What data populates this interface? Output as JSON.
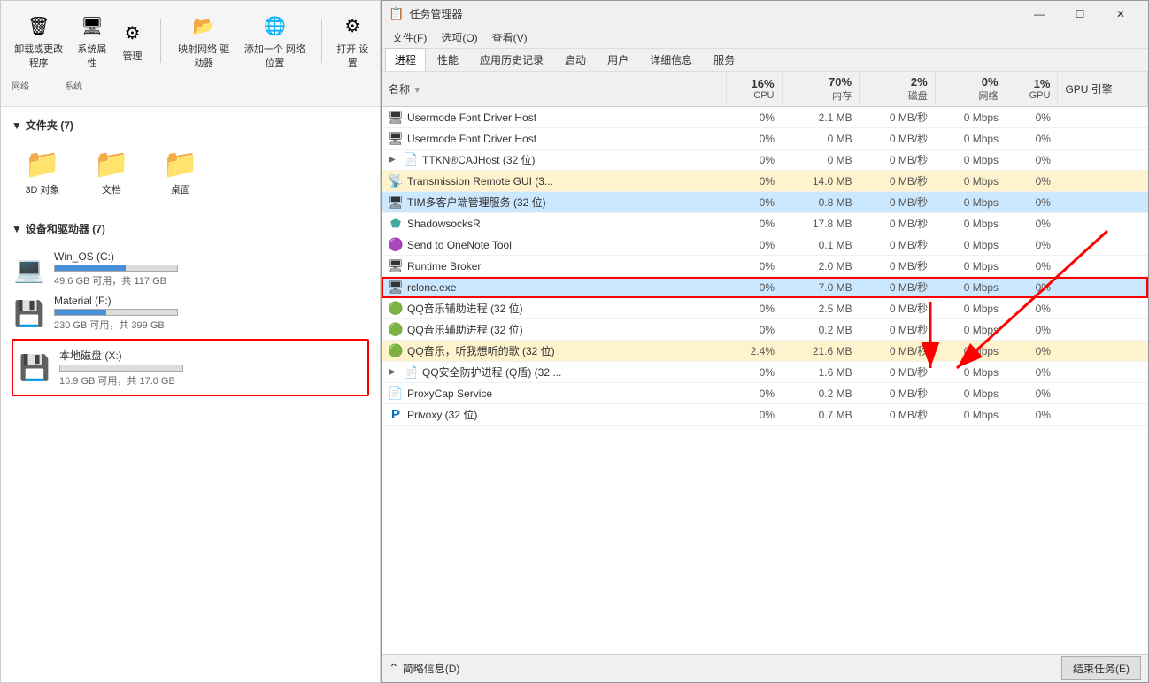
{
  "fileExplorer": {
    "ribbon": {
      "uninstall": "卸载或更改程序",
      "systemProps": "系统属性",
      "manage": "管理",
      "openSettings": "打开\n设置",
      "addNetwork": "添加一个\n网络位置",
      "mapDrive": "映射网络\n驱动器",
      "networkGroup": "网络",
      "systemGroup": "系统"
    },
    "sections": {
      "folders": {
        "title": "文件夹 (7)",
        "items": [
          {
            "name": "3D 对象",
            "icon": "📁"
          },
          {
            "name": "文档",
            "icon": "📁"
          },
          {
            "name": "桌面",
            "icon": "📁"
          }
        ]
      },
      "devices": {
        "title": "设备和驱动器 (7)",
        "items": [
          {
            "name": "Win_OS (C:)",
            "icon": "💻",
            "free": "49.6 GB 可用，共 117 GB",
            "usedPct": 58
          },
          {
            "name": "Material (F:)",
            "icon": "💾",
            "free": "230 GB 可用，共 399 GB",
            "usedPct": 42
          },
          {
            "name": "本地磁盘 (X:)",
            "icon": "💾",
            "free": "16.9 GB 可用，共 17.0 GB",
            "usedPct": 0,
            "highlight": true
          }
        ]
      }
    }
  },
  "taskManager": {
    "title": "任务管理器",
    "menuItems": [
      "文件(F)",
      "选项(O)",
      "查看(V)"
    ],
    "tabs": [
      "进程",
      "性能",
      "应用历史记录",
      "启动",
      "用户",
      "详细信息",
      "服务"
    ],
    "activeTab": "进程",
    "columns": [
      {
        "label": "名称",
        "key": "name"
      },
      {
        "label": "CPU",
        "pct": "16%",
        "sub": "CPU"
      },
      {
        "label": "内存",
        "pct": "70%",
        "sub": "内存"
      },
      {
        "label": "磁盘",
        "pct": "2%",
        "sub": "磁盘"
      },
      {
        "label": "网络",
        "pct": "0%",
        "sub": "网络"
      },
      {
        "label": "GPU",
        "pct": "1%",
        "sub": "GPU"
      },
      {
        "label": "GPU 引擎",
        "key": "gpuEngine"
      }
    ],
    "rows": [
      {
        "name": "Usermode Font Driver Host",
        "cpu": "0%",
        "mem": "2.1 MB",
        "disk": "0 MB/秒",
        "net": "0 Mbps",
        "gpu": "0%",
        "gpuEngine": "",
        "icon": "🖥",
        "highlighted": false
      },
      {
        "name": "Usermode Font Driver Host",
        "cpu": "0%",
        "mem": "0 MB",
        "disk": "0 MB/秒",
        "net": "0 Mbps",
        "gpu": "0%",
        "gpuEngine": "",
        "icon": "🖥",
        "highlighted": false
      },
      {
        "name": "TTKN®CAJHost (32 位)",
        "cpu": "0%",
        "mem": "0 MB",
        "disk": "0 MB/秒",
        "net": "0 Mbps",
        "gpu": "0%",
        "gpuEngine": "",
        "icon": "📄",
        "highlighted": false,
        "expandable": true
      },
      {
        "name": "Transmission Remote GUI (3...",
        "cpu": "0%",
        "mem": "14.0 MB",
        "disk": "0 MB/秒",
        "net": "0 Mbps",
        "gpu": "0%",
        "gpuEngine": "",
        "icon": "📡",
        "highlighted": true
      },
      {
        "name": "TIM多客户端管理服务 (32 位)",
        "cpu": "0%",
        "mem": "0.8 MB",
        "disk": "0 MB/秒",
        "net": "0 Mbps",
        "gpu": "0%",
        "gpuEngine": "",
        "icon": "🖥",
        "highlighted": true,
        "selected": true
      },
      {
        "name": "ShadowsocksR",
        "cpu": "0%",
        "mem": "17.8 MB",
        "disk": "0 MB/秒",
        "net": "0 Mbps",
        "gpu": "0%",
        "gpuEngine": "",
        "icon": "🔵",
        "highlighted": false
      },
      {
        "name": "Send to OneNote Tool",
        "cpu": "0%",
        "mem": "0.1 MB",
        "disk": "0 MB/秒",
        "net": "0 Mbps",
        "gpu": "0%",
        "gpuEngine": "",
        "icon": "🟣",
        "highlighted": false
      },
      {
        "name": "Runtime Broker",
        "cpu": "0%",
        "mem": "2.0 MB",
        "disk": "0 MB/秒",
        "net": "0 Mbps",
        "gpu": "0%",
        "gpuEngine": "",
        "icon": "🖥",
        "highlighted": false
      },
      {
        "name": "rclone.exe",
        "cpu": "0%",
        "mem": "7.0 MB",
        "disk": "0 MB/秒",
        "net": "0 Mbps",
        "gpu": "0%",
        "gpuEngine": "",
        "icon": "🖥",
        "highlighted": false,
        "rclone": true
      },
      {
        "name": "QQ音乐辅助进程 (32 位)",
        "cpu": "0%",
        "mem": "2.5 MB",
        "disk": "0 MB/秒",
        "net": "0 Mbps",
        "gpu": "0%",
        "gpuEngine": "",
        "icon": "🟢",
        "highlighted": false
      },
      {
        "name": "QQ音乐辅助进程 (32 位)",
        "cpu": "0%",
        "mem": "0.2 MB",
        "disk": "0 MB/秒",
        "net": "0 Mbps",
        "gpu": "0%",
        "gpuEngine": "",
        "icon": "🟢",
        "highlighted": false
      },
      {
        "name": "QQ音乐，听我想听的歌 (32 位)",
        "cpu": "2.4%",
        "mem": "21.6 MB",
        "disk": "0 MB/秒",
        "net": "0 Mbps",
        "gpu": "0%",
        "gpuEngine": "",
        "icon": "🟢",
        "highlighted": false
      },
      {
        "name": "QQ安全防护进程 (Q盾) (32 ...",
        "cpu": "0%",
        "mem": "1.6 MB",
        "disk": "0 MB/秒",
        "net": "0 Mbps",
        "gpu": "0%",
        "gpuEngine": "",
        "icon": "📄",
        "highlighted": false,
        "expandable": true
      },
      {
        "name": "ProxyCap Service",
        "cpu": "0%",
        "mem": "0.2 MB",
        "disk": "0 MB/秒",
        "net": "0 Mbps",
        "gpu": "0%",
        "gpuEngine": "",
        "icon": "📄",
        "highlighted": false
      },
      {
        "name": "Privoxy (32 位)",
        "cpu": "0%",
        "mem": "0.7 MB",
        "disk": "0 MB/秒",
        "net": "0 Mbps",
        "gpu": "0%",
        "gpuEngine": "",
        "icon": "🅿",
        "highlighted": false
      }
    ],
    "footer": {
      "summaryLabel": "简略信息(D)",
      "endTaskLabel": "结束任务(E)"
    }
  }
}
